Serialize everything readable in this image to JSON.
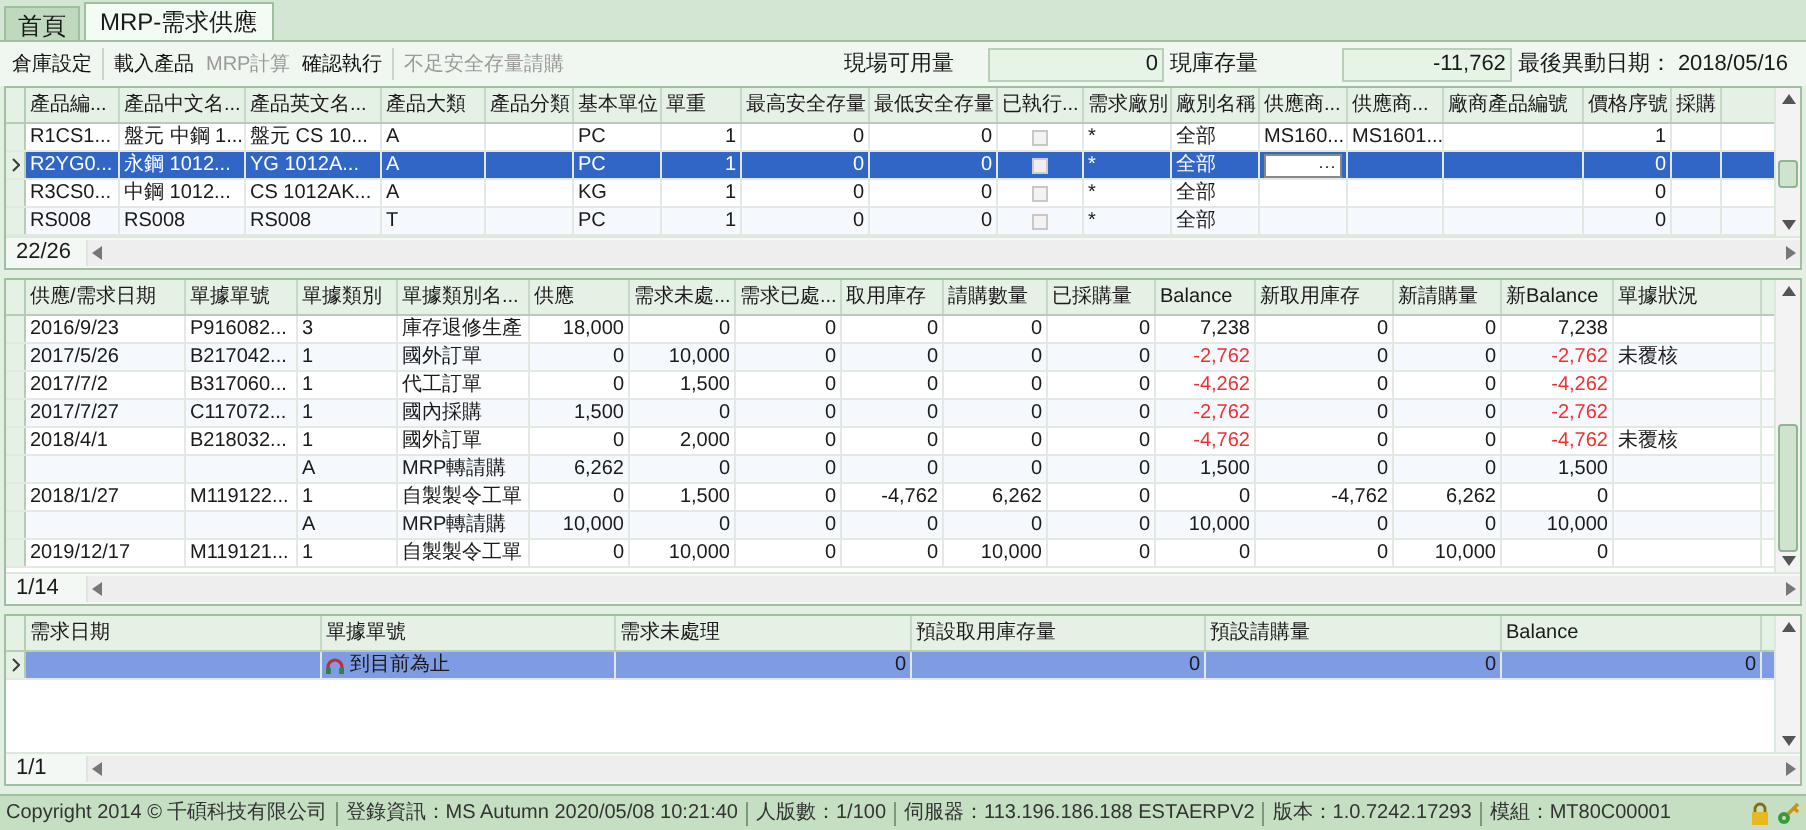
{
  "tabs": [
    {
      "label": "首頁",
      "selected": false
    },
    {
      "label": "MRP-需求供應",
      "selected": true
    }
  ],
  "toolbar": [
    {
      "label": "倉庫設定",
      "disabled": false
    },
    {
      "label": "載入產品",
      "disabled": false
    },
    {
      "label": "MRP計算",
      "disabled": true
    },
    {
      "label": "確認執行",
      "disabled": false
    },
    {
      "label": "不足安全存量請購",
      "disabled": true
    }
  ],
  "info": {
    "available_label": "現場可用量",
    "available_value": "0",
    "stock_label": "現庫存量",
    "stock_value": "-11,762",
    "last_change_label": "最後異動日期：",
    "last_change_value": "2018/05/16"
  },
  "product_grid": {
    "columns": [
      "產品編...",
      "產品中文名...",
      "產品英文名...",
      "產品大類",
      "產品分類",
      "基本單位",
      "單重",
      "最高安全存量",
      "最低安全存量",
      "已執行...",
      "需求廠別",
      "廠別名稱",
      "供應商...",
      "供應商...",
      "廠商產品編號",
      "價格序號",
      "採購"
    ],
    "rows": [
      {
        "selected": false,
        "cells": [
          "R1CS1...",
          "盤元 中鋼 1...",
          "盤元 CS 10...",
          "A",
          null,
          "PC",
          "1",
          "0",
          "0",
          {
            "kind": "check",
            "checked": false
          },
          "*",
          "全部",
          "MS160...",
          "MS1601...",
          null,
          "1",
          null
        ]
      },
      {
        "selected": true,
        "cells": [
          "R2YG0...",
          "永鋼 1012...",
          "YG 1012A...",
          "A",
          null,
          "PC",
          "1",
          "0",
          "0",
          {
            "kind": "check",
            "checked": false
          },
          "*",
          "全部",
          {
            "kind": "editor",
            "text": "···"
          },
          null,
          null,
          "0",
          null
        ]
      },
      {
        "selected": false,
        "cells": [
          "R3CS0...",
          "中鋼 1012...",
          "CS 1012AK...",
          "A",
          null,
          "KG",
          "1",
          "0",
          "0",
          {
            "kind": "check",
            "checked": false
          },
          "*",
          "全部",
          null,
          null,
          null,
          "0",
          null
        ]
      },
      {
        "selected": false,
        "cells": [
          "RS008",
          "RS008",
          "RS008",
          "T",
          null,
          "PC",
          "1",
          "0",
          "0",
          {
            "kind": "check",
            "checked": false
          },
          "*",
          "全部",
          null,
          null,
          null,
          "0",
          null
        ]
      }
    ],
    "pager": "22/26"
  },
  "supply_grid": {
    "columns": [
      "供應/需求日期",
      "單據單號",
      "單據類別",
      "單據類別名...",
      "供應",
      "需求未處...",
      "需求已處...",
      "取用庫存",
      "請購數量",
      "已採購量",
      "Balance",
      "新取用庫存",
      "新請購量",
      "新Balance",
      "單據狀況"
    ],
    "rows": [
      {
        "selected": false,
        "cells": [
          "2016/9/23",
          "P916082...",
          "3",
          "庫存退修生產",
          "18,000",
          "0",
          "0",
          "0",
          "0",
          "0",
          "7,238",
          "0",
          "0",
          "7,238",
          null
        ]
      },
      {
        "selected": false,
        "cells": [
          "2017/5/26",
          "B217042...",
          "1",
          "國外訂單",
          "0",
          "10,000",
          "0",
          "0",
          "0",
          "0",
          {
            "kind": "alert",
            "text": "-2,762"
          },
          "0",
          "0",
          {
            "kind": "alert",
            "text": "-2,762"
          },
          "未覆核"
        ]
      },
      {
        "selected": false,
        "cells": [
          "2017/7/2",
          "B317060...",
          "1",
          "代工訂單",
          "0",
          "1,500",
          "0",
          "0",
          "0",
          "0",
          {
            "kind": "alert",
            "text": "-4,262"
          },
          "0",
          "0",
          {
            "kind": "alert",
            "text": "-4,262"
          },
          null
        ]
      },
      {
        "selected": false,
        "cells": [
          "2017/7/27",
          "C117072...",
          "1",
          "國內採購",
          "1,500",
          "0",
          "0",
          "0",
          "0",
          "0",
          {
            "kind": "alert",
            "text": "-2,762"
          },
          "0",
          "0",
          {
            "kind": "alert",
            "text": "-2,762"
          },
          null
        ]
      },
      {
        "selected": false,
        "cells": [
          "2018/4/1",
          "B218032...",
          "1",
          "國外訂單",
          "0",
          "2,000",
          "0",
          "0",
          "0",
          "0",
          {
            "kind": "alert",
            "text": "-4,762"
          },
          "0",
          "0",
          {
            "kind": "alert",
            "text": "-4,762"
          },
          "未覆核"
        ]
      },
      {
        "selected": false,
        "cells": [
          null,
          null,
          "A",
          "MRP轉請購",
          "6,262",
          "0",
          "0",
          "0",
          "0",
          "0",
          "1,500",
          "0",
          "0",
          "1,500",
          null
        ]
      },
      {
        "selected": false,
        "cells": [
          "2018/1/27",
          "M119122...",
          "1",
          "自製製令工單",
          "0",
          "1,500",
          "0",
          "-4,762",
          "6,262",
          "0",
          "0",
          "-4,762",
          "6,262",
          "0",
          null
        ]
      },
      {
        "selected": false,
        "cells": [
          null,
          null,
          "A",
          "MRP轉請購",
          "10,000",
          "0",
          "0",
          "0",
          "0",
          "0",
          "10,000",
          "0",
          "0",
          "10,000",
          null
        ]
      },
      {
        "selected": false,
        "cells": [
          "2019/12/17",
          "M119121...",
          "1",
          "自製製令工單",
          "0",
          "10,000",
          "0",
          "0",
          "10,000",
          "0",
          "0",
          "0",
          "10,000",
          "0",
          null
        ]
      }
    ],
    "pager": "1/14"
  },
  "summary_grid": {
    "columns": [
      "需求日期",
      "單據單號",
      "需求未處理",
      "預設取用庫存量",
      "預設請購量",
      "Balance"
    ],
    "rows": [
      {
        "selected": true,
        "cells": [
          null,
          {
            "kind": "node",
            "text": "到目前為止"
          },
          "0",
          "0",
          "0",
          "0"
        ]
      }
    ],
    "pager": "1/1"
  },
  "status_bar": [
    "Copyright 2014 © 千碩科技有限公司",
    "登錄資訊：MS Autumn 2020/05/08 10:21:40",
    "人版數：1/100",
    "伺服器：113.196.186.188 ESTAERPV2",
    "版本：1.0.7242.17293",
    "模組：MT80C00001"
  ]
}
